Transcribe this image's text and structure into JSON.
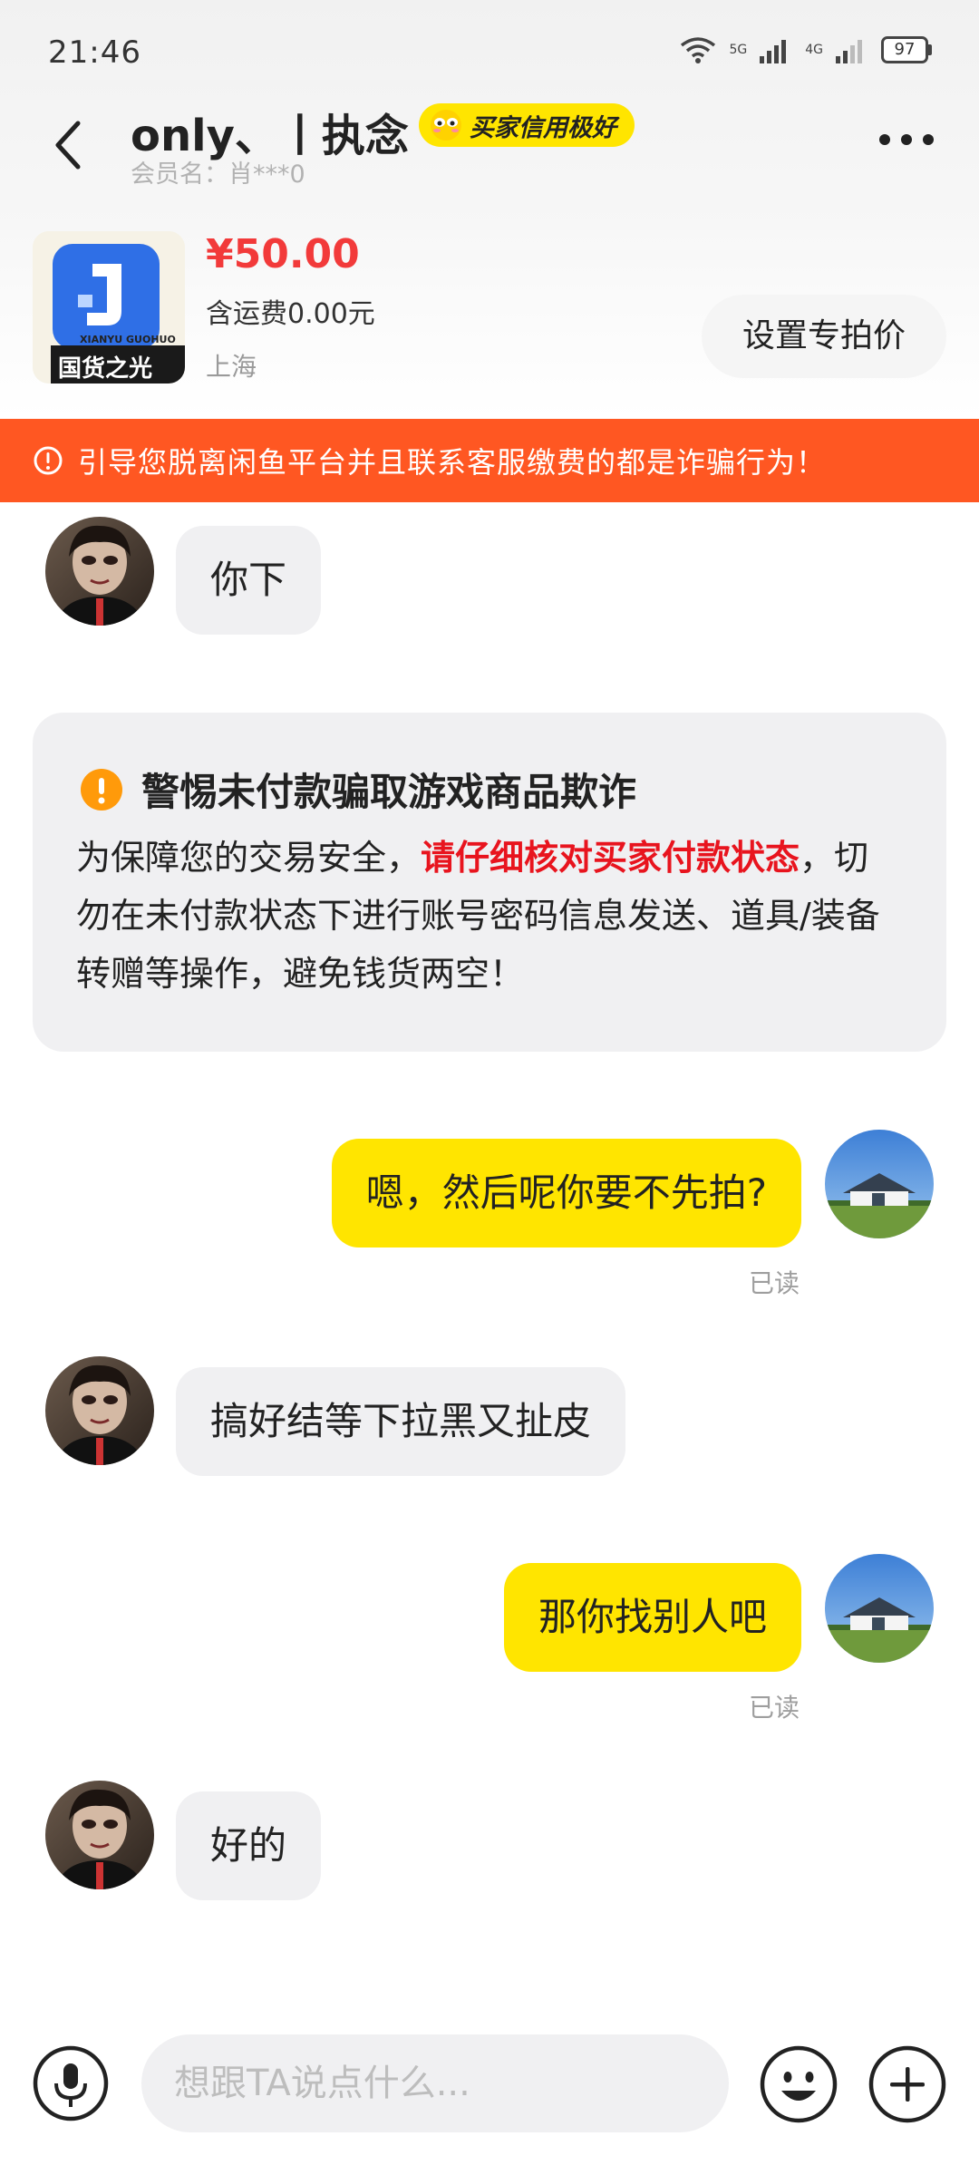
{
  "status_bar": {
    "time": "21:46",
    "signal_1": "5G",
    "signal_2": "4G",
    "battery": "97"
  },
  "header": {
    "name": "only、丨执念",
    "credit_badge": "买家信用极好",
    "member_label": "会员名：肖***0"
  },
  "product": {
    "price": "¥50.00",
    "shipping": "含运费0.00元",
    "location": "上海",
    "thumb_brand": "XIANYU GUOHUO",
    "thumb_caption": "国货之光",
    "set_price_button": "设置专拍价"
  },
  "warning_banner": {
    "text": "引导您脱离闲鱼平台并且联系客服缴费的都是诈骗行为！"
  },
  "messages": [
    {
      "from": "other",
      "text": "你下"
    },
    {
      "from": "me",
      "text": "嗯，然后呢你要不先拍?",
      "status": "已读"
    },
    {
      "from": "other",
      "text": "搞好结等下拉黑又扯皮"
    },
    {
      "from": "me",
      "text": "那你找别人吧",
      "status": "已读"
    },
    {
      "from": "other",
      "text": "好的"
    }
  ],
  "notice": {
    "title": "警惕未付款骗取游戏商品欺诈",
    "body_prefix": "为保障您的交易安全，",
    "body_highlight": "请仔细核对买家付款状态",
    "body_suffix": "，切勿在未付款状态下进行账号密码信息发送、道具/装备转赠等操作，避免钱货两空！"
  },
  "input_bar": {
    "placeholder": "想跟TA说点什么..."
  },
  "icons": {
    "back": "back-arrow-icon",
    "more": "more-dots-icon",
    "warning": "alert-circle-icon",
    "notice": "exclamation-circle-icon",
    "mic": "microphone-icon",
    "emoji": "emoji-icon",
    "plus": "plus-icon"
  },
  "colors": {
    "accent_yellow": "#ffe500",
    "warning_orange": "#ff5722",
    "price_red": "#f23a3a",
    "highlight_red": "#e8141e"
  }
}
